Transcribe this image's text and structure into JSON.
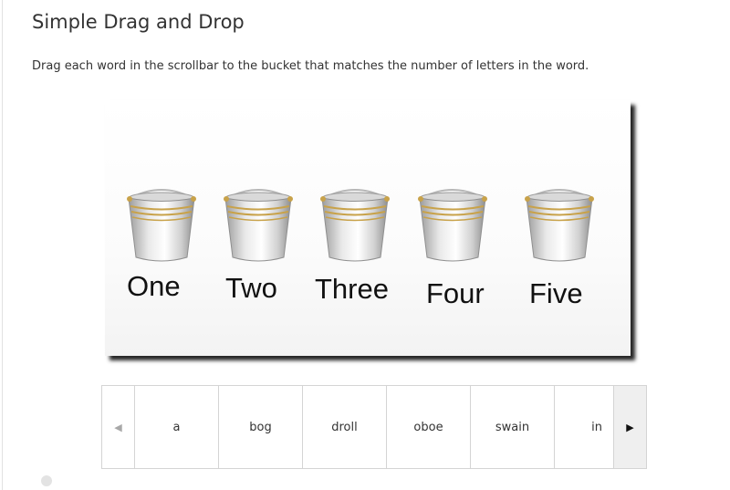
{
  "header": {
    "title": "Simple Drag and Drop",
    "instructions": "Drag each word in the scrollbar to the bucket that matches the number of letters in the word."
  },
  "buckets": [
    {
      "label": "One"
    },
    {
      "label": "Two"
    },
    {
      "label": "Three"
    },
    {
      "label": "Four"
    },
    {
      "label": "Five"
    }
  ],
  "scroller": {
    "left_arrow": "◀",
    "right_arrow": "▶",
    "words": [
      "a",
      "bog",
      "droll",
      "oboe",
      "swain",
      "in"
    ]
  },
  "colors": {
    "text": "#333333",
    "border": "#d4d4d4",
    "right_arrow_bg": "#efefef"
  }
}
